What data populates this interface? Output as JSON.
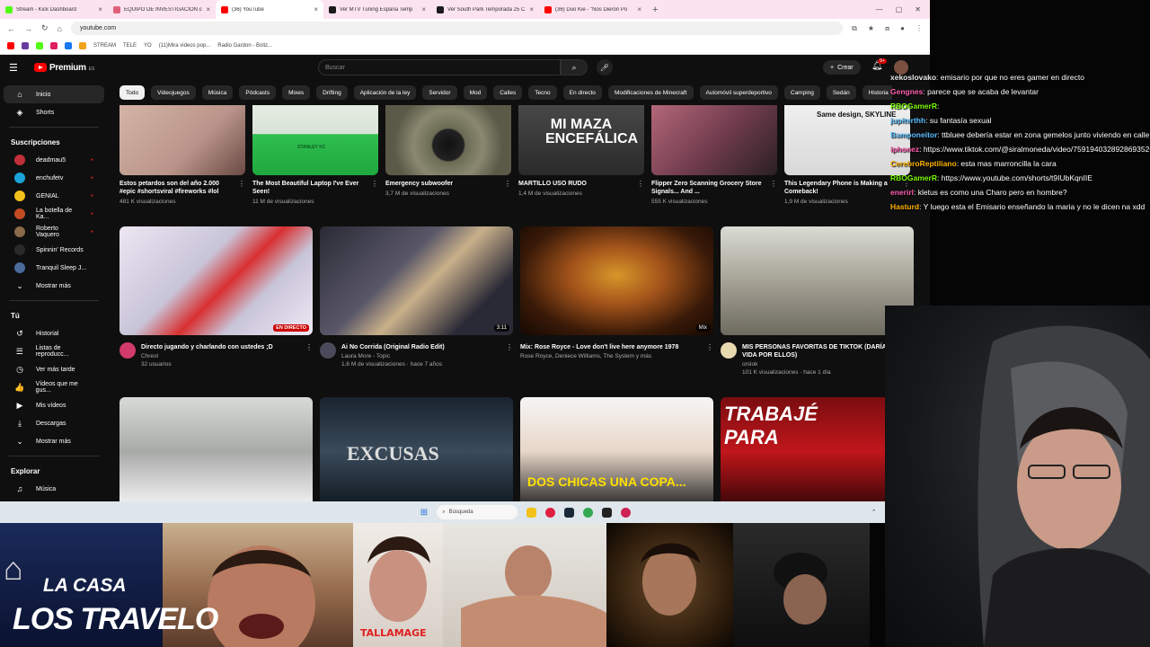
{
  "browser": {
    "tabs": [
      {
        "title": "Stream - Kick Dashboard",
        "color": "#53fc18",
        "active": false
      },
      {
        "title": "EQUIPO DE INVESTIGACIÓN co",
        "color": "#e0607a",
        "active": false
      },
      {
        "title": "(36) YouTube",
        "color": "#ff0000",
        "active": true
      },
      {
        "title": "Ver MTV Tuning España Temp",
        "color": "#1a1a1a",
        "active": false
      },
      {
        "title": "Ver South Park Temporada 25 C",
        "color": "#1a1a1a",
        "active": false
      },
      {
        "title": "(36) Duo Kie - \"Nos Dieron Po",
        "color": "#ff0000",
        "active": false
      }
    ],
    "new_tab": "+",
    "url": "youtube.com",
    "bookmarks": [
      "STREAM",
      "TELE",
      "YO",
      "(11)Mira videos pop...",
      "Radio Gardon - Boliz..."
    ]
  },
  "youtube": {
    "logo_text": "Premium",
    "logo_region": "ES",
    "search_placeholder": "Buscar",
    "create_label": "Crear",
    "notif_count": "9+",
    "sidebar": {
      "main": [
        {
          "label": "Inicio",
          "icon": "home-icon",
          "glyph": "⌂",
          "active": true
        },
        {
          "label": "Shorts",
          "icon": "shorts-icon",
          "glyph": "◈",
          "active": false
        }
      ],
      "subs_header": "Suscripciones",
      "subs": [
        {
          "label": "deadmau5",
          "color": "#c0303a",
          "live": true
        },
        {
          "label": "enchufetv",
          "color": "#1aa4d8",
          "live": true
        },
        {
          "label": "GENIAL",
          "color": "#f2c21a",
          "live": true
        },
        {
          "label": "La botella de Ka...",
          "color": "#c44a22",
          "live": true
        },
        {
          "label": "Roberto Vaquero",
          "color": "#8a6a4a",
          "live": true
        },
        {
          "label": "Spinnin' Records",
          "color": "#2a2a2a",
          "live": false
        },
        {
          "label": "Tranquil Sleep J...",
          "color": "#4a6a9a",
          "live": false
        }
      ],
      "show_more": "Mostrar más",
      "you_header": "Tú",
      "you": [
        {
          "label": "Historial",
          "glyph": "↺",
          "icon": "history-icon"
        },
        {
          "label": "Listas de reproducc...",
          "glyph": "☰",
          "icon": "playlists-icon"
        },
        {
          "label": "Ver más tarde",
          "glyph": "◷",
          "icon": "watch-later-icon"
        },
        {
          "label": "Vídeos que me gus...",
          "glyph": "👍",
          "icon": "liked-icon"
        },
        {
          "label": "Mis vídeos",
          "glyph": "▶",
          "icon": "my-videos-icon"
        },
        {
          "label": "Descargas",
          "glyph": "⤓",
          "icon": "downloads-icon"
        },
        {
          "label": "Mostrar más",
          "glyph": "⌄",
          "icon": "chevron-down-icon"
        }
      ],
      "explore_header": "Explorar",
      "explore": [
        {
          "label": "Música",
          "glyph": "♫",
          "icon": "music-icon"
        }
      ]
    },
    "chips": [
      "Todo",
      "Videojuegos",
      "Música",
      "Pódcasts",
      "Mixes",
      "Drifting",
      "Aplicación de la ley",
      "Servidor",
      "Mod",
      "Calles",
      "Tecno",
      "En directo",
      "Modificaciones de Minecraft",
      "Automóvil superdeportivo",
      "Camping",
      "Sedán",
      "Historia"
    ],
    "row1": [
      {
        "title": "Estos petardos son del año 2.000 #epic #shortsviral #fireworks #lol",
        "meta": "481 K visualizaciones",
        "bg": "linear-gradient(135deg,#d6b5a8,#b9948a 60%,#6a4a44)"
      },
      {
        "title": "The Most Beautiful Laptop I've Ever Seen!",
        "meta": "11 M de visualizaciones",
        "bg": "linear-gradient(180deg,#e8eee6 0%,#d9e3d6 45%,#2fbf4f 46%,#1fa83e 100%)"
      },
      {
        "title": "Emergency subwoofer",
        "meta": "3,7 M de visualizaciones",
        "bg": "radial-gradient(circle at 50% 60%,#111 0%,#222 20%,#6b6b55 22%,#8a8870 45%,#5a5a48 70%)"
      },
      {
        "title": "MARTILLO USO RUDO",
        "meta": "1,4 M de visualizaciones",
        "bg": "linear-gradient(180deg,#4a4a4a,#2a2a2a)"
      },
      {
        "title": "Flipper Zero Scanning Grocery Store Signals... And ...",
        "meta": "555 K visualizaciones",
        "bg": "linear-gradient(135deg,#b76a7a,#6d3a4c 55%,#2a2024)"
      },
      {
        "title": "This Legendary Phone is Making a Comeback!",
        "meta": "1,9 M de visualizaciones",
        "bg": "linear-gradient(180deg,#f1f1f1,#d8d8d8)"
      }
    ],
    "row2": [
      {
        "title": "Directo jugando y charlando con ustedes ;D",
        "channel": "Chrest",
        "meta": "32 usuarios",
        "badge": "EN DIRECTO",
        "badge_type": "live",
        "av": "#d23a6a",
        "bg": "linear-gradient(135deg,#ece6f2,#c8c4d8 40%,#d83030 55%,#c8c4d8 70%,#efe9f5)"
      },
      {
        "title": "Ai No Corrida (Original Radio Edit)",
        "channel": "Laura More - Topic",
        "meta": "1,6 M de visualizaciones · hace 7 años",
        "badge": "3:11",
        "badge_type": "dur",
        "av": "#4a4a5a",
        "bg": "linear-gradient(135deg,#2a2a36,#5a5868 40%,#c9b08a 55%,#2a2a36 80%)"
      },
      {
        "title": "Mix: Rose Royce - Love don't live here anymore 1978",
        "channel": "Rose Royce, Deniece Williams, The System y más",
        "meta": "",
        "badge": "Mix",
        "badge_type": "dur",
        "av": "",
        "bg": "radial-gradient(ellipse at 50% 45%,#d8962a 0%,#a0521a 35%,#3a1a08 70%,#140802 100%)"
      },
      {
        "title": "MIS PERSONAS FAVORITAS DE TIKTOK (DARÍA MI VIDA POR ELLOS)",
        "channel": "orslok",
        "meta": "101 K visualizaciones · hace 1 día",
        "badge": "20:02",
        "badge_type": "dur",
        "av": "#e8d8b0",
        "bg": "linear-gradient(180deg,#d9dcd4,#a6a296 50%,#6d6a60)"
      }
    ],
    "row3": [
      {
        "bg": "linear-gradient(180deg,#d8dad8,#a8aaa8 50%,#f2f2f2)"
      },
      {
        "bg": "linear-gradient(180deg,#1a2430,#3a4a5a 50%,#111a22)",
        "text": "EXCUSAS"
      },
      {
        "bg": "linear-gradient(180deg,#f5f5f5,#e7d6c8 50%,#2a2a2a)",
        "text": "DOS CHICAS UNA COPA..."
      },
      {
        "bg": "linear-gradient(180deg,#7a0d10,#c0161b 50%,#3a0608)",
        "text": "TRABAJÉ PARA"
      }
    ]
  },
  "row1_thumb_text": [
    "",
    "STANLEY KC",
    "",
    "MI MAZA ENCEFÁLICA",
    "",
    "Same design, SKYLINE"
  ],
  "chat": [
    {
      "user": "xekoslovako",
      "color": "#e8e8e8",
      "text": ": emisario por que no eres gamer en directo"
    },
    {
      "user": "Gengnes",
      "color": "#ff5fb0",
      "text": ": parece que se acaba de levantar"
    },
    {
      "user": "RBOGamerR",
      "color": "#7cfc00",
      "text": ":"
    },
    {
      "user": "jupiterthh",
      "color": "#5bc0ff",
      "text": ": su fantasía sexual"
    },
    {
      "user": "Bamponeitor",
      "color": "#5bc0ff",
      "text": ": ttbluee debería estar en zona gemelos junto viviendo en calle"
    },
    {
      "user": "iphonez",
      "color": "#ff5fb0",
      "text": ": https://www.tiktok.com/@siralmoneda/video/7591940328928693526"
    },
    {
      "user": "CerebroReptiliano",
      "color": "#ffb300",
      "text": ": esta mas marroncilla la cara"
    },
    {
      "user": "RBOGamerR",
      "color": "#7cfc00",
      "text": ": https://www.youtube.com/shorts/t9IUbKqnIIE"
    },
    {
      "user": "enerirl",
      "color": "#ff5fb0",
      "text": ": kletus es como una Charo pero en hombre?"
    },
    {
      "user": "Hasturd",
      "color": "#ffb300",
      "text": ": Y luego esta el Emisario enseñando la maria y no le dicen na xdd"
    }
  ],
  "taskbar": {
    "search": "Búsqueda"
  },
  "overlay": {
    "logo_line1": "LA CASA",
    "logo_line2": "LOS TRAVELO",
    "clip_caption": "TALLAMAGE"
  }
}
